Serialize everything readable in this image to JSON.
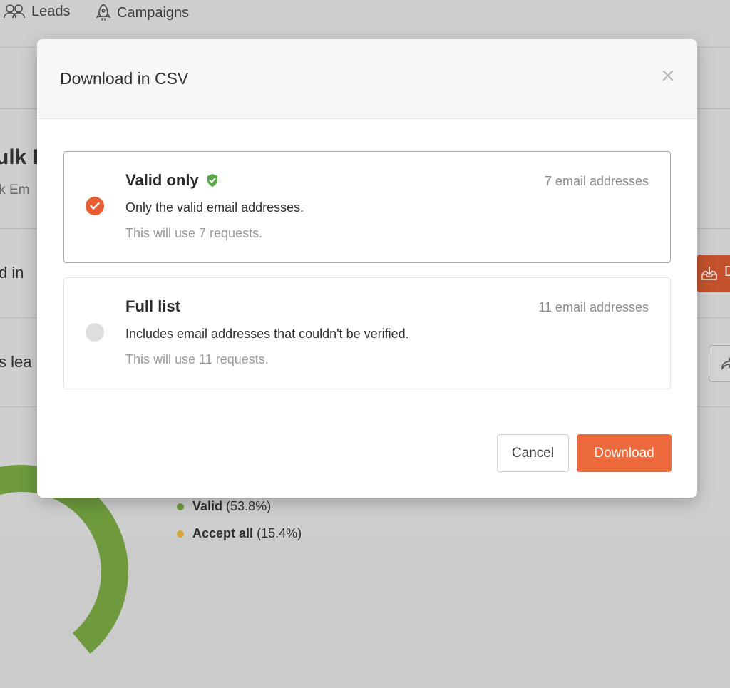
{
  "nav": {
    "leads": "Leads",
    "campaigns": "Campaigns"
  },
  "background": {
    "title_fragment": "ulk E",
    "subtitle_fragment": "lk Em",
    "row1_fragment": "d in",
    "row2_fragment": "s lea",
    "download_button_fragment": "D",
    "legend": [
      {
        "label": "Valid",
        "value": "(53.8%)",
        "color": "#6e9a3d"
      },
      {
        "label": "Accept all",
        "value": "(15.4%)",
        "color": "#d9a33a"
      }
    ]
  },
  "modal": {
    "title": "Download in CSV",
    "options": [
      {
        "title": "Valid only",
        "count": "7 email addresses",
        "description": "Only the valid email addresses.",
        "note": "This will use 7 requests.",
        "selected": true
      },
      {
        "title": "Full list",
        "count": "11 email addresses",
        "description": "Includes email addresses that couldn't be verified.",
        "note": "This will use 11 requests.",
        "selected": false
      }
    ],
    "cancel_label": "Cancel",
    "download_label": "Download"
  },
  "colors": {
    "accent": "#ec6a3c",
    "selected_radio": "#e95d35",
    "verified_badge": "#5aa845"
  }
}
